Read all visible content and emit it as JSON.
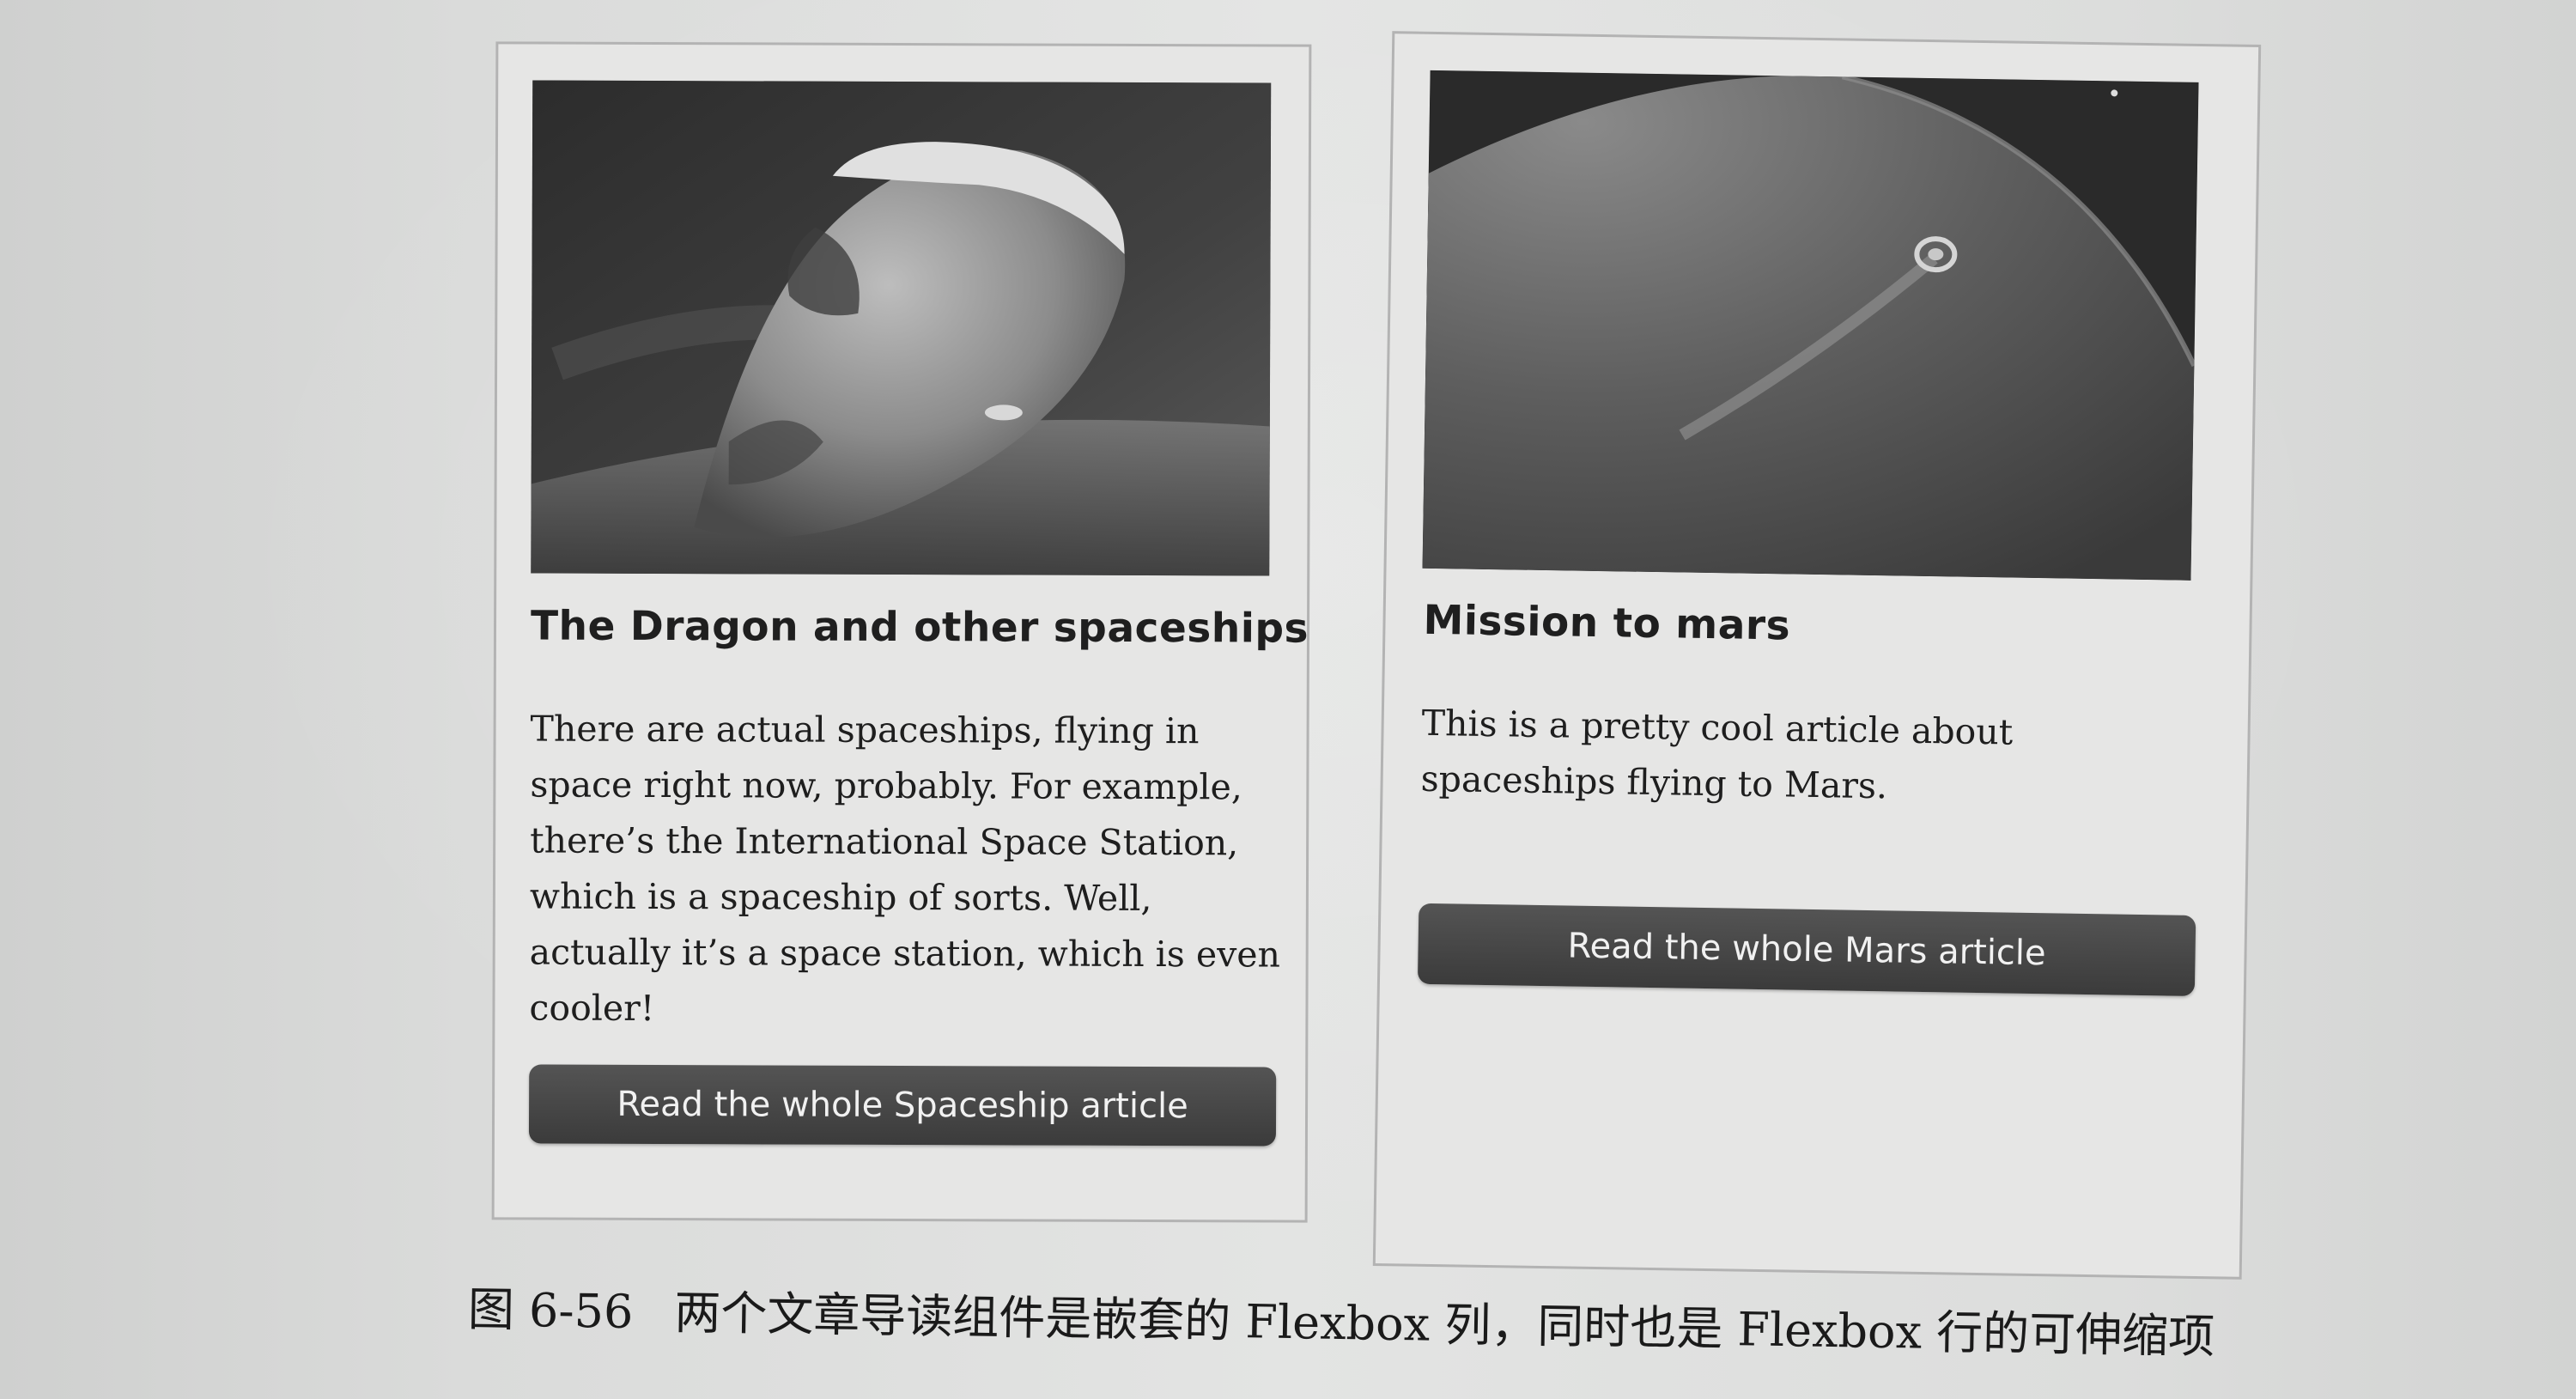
{
  "cards": [
    {
      "title": "The Dragon and other spaceships",
      "text": "There are actual spaceships, flying in space right now, probably. For example, there’s the International Space Station, which is a spaceship of sorts. Well, actually it’s a space station, which is even cooler!",
      "button": "Read the whole Spaceship article"
    },
    {
      "title": "Mission to mars",
      "text": "This is a pretty cool article about spaceships flying to Mars.",
      "button": "Read the whole Mars article"
    }
  ],
  "caption": {
    "figure_number": "图 6-56",
    "text": "两个文章导读组件是嵌套的 Flexbox 列，同时也是 Flexbox 行的可伸缩项"
  },
  "colors": {
    "paper": "#e3e4e3",
    "card_background": "#e6e6e5",
    "card_border": "#b3b3b3",
    "button": "#474747",
    "button_text": "#f1f1f1",
    "text": "#1e1e1e"
  }
}
